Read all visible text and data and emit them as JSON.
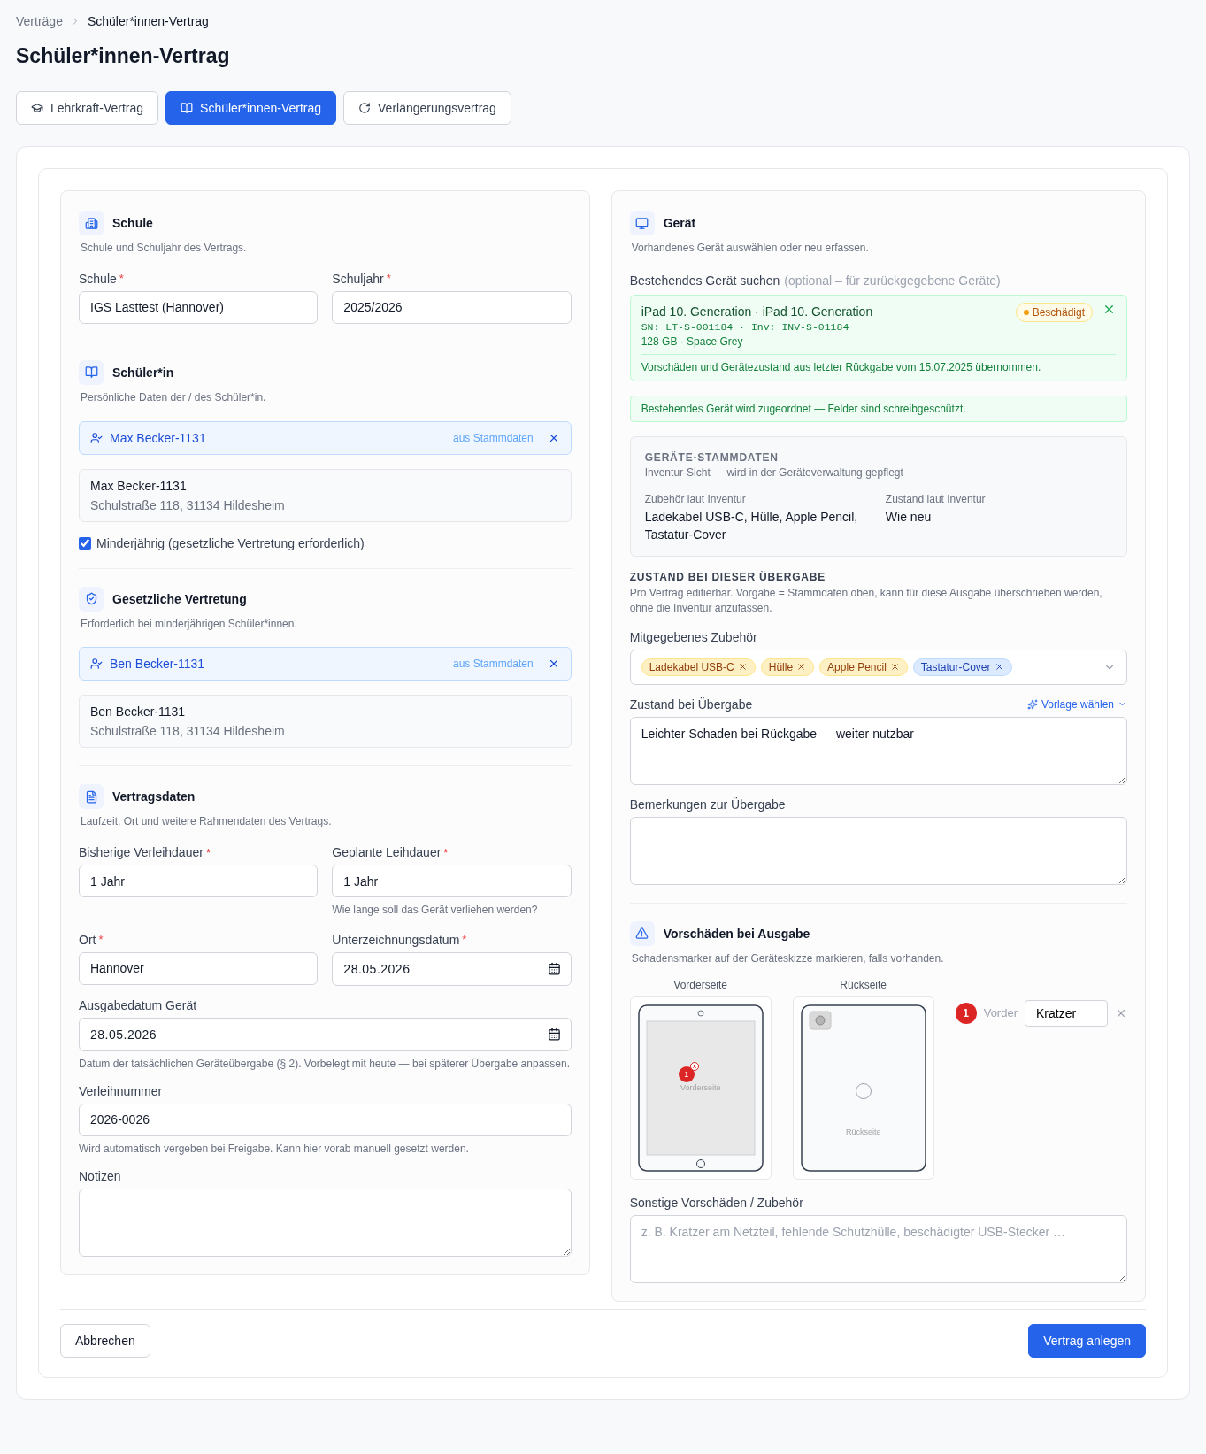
{
  "breadcrumb": [
    {
      "label": "Verträge",
      "current": false
    },
    {
      "label": "Schüler*innen-Vertrag",
      "current": true
    }
  ],
  "title": "Schüler*innen-Vertrag",
  "tabs": [
    {
      "label": "Lehrkraft-Vertrag",
      "selected": false
    },
    {
      "label": "Schüler*innen-Vertrag",
      "selected": true
    },
    {
      "label": "Verlängerungsvertrag",
      "selected": false
    }
  ],
  "required_mark": "*",
  "school": {
    "title": "Schule",
    "subtitle": "Schule und Schuljahr des Vertrags.",
    "fields": [
      {
        "label": "Schule",
        "required": true,
        "value": "IGS Lasttest (Hannover)"
      },
      {
        "label": "Schuljahr",
        "required": true,
        "value": "2025/2026"
      }
    ]
  },
  "student": {
    "title": "Schüler*in",
    "subtitle": "Persönliche Daten der / des Schüler*in.",
    "chip": {
      "name": "Max Becker-1131",
      "source": "aus Stammdaten"
    },
    "card": {
      "name": "Max Becker-1131",
      "address": "Schulstraße 118, 31134 Hildesheim"
    },
    "minor": {
      "label": "Minderjährig (gesetzliche Vertretung erforderlich)",
      "checked": true
    }
  },
  "guardian": {
    "title": "Gesetzliche Vertretung",
    "subtitle": "Erforderlich bei minderjährigen Schüler*innen.",
    "chip": {
      "name": "Ben Becker-1131",
      "source": "aus Stammdaten"
    },
    "card": {
      "name": "Ben Becker-1131",
      "address": "Schulstraße 118, 31134 Hildesheim"
    }
  },
  "contract": {
    "title": "Vertragsdaten",
    "subtitle": "Laufzeit, Ort und weitere Rahmendaten des Vertrags.",
    "grid_fields": [
      {
        "kind": "text",
        "label": "Bisherige Verleihdauer",
        "required": true,
        "value": "1 Jahr"
      },
      {
        "kind": "text",
        "label": "Geplante Leihdauer",
        "required": true,
        "value": "1 Jahr",
        "hint": "Wie lange soll das Gerät verliehen werden?"
      },
      {
        "kind": "text",
        "label": "Ort",
        "required": true,
        "value": "Hannover"
      },
      {
        "kind": "date",
        "label": "Unterzeichnungsdatum",
        "required": true,
        "value": "28.05.2026"
      }
    ],
    "wide_fields": [
      {
        "kind": "date",
        "label": "Ausgabedatum Gerät",
        "value": "28.05.2026",
        "hint": "Datum der tatsächlichen Geräteübergabe (§ 2). Vorbelegt mit heute — bei späterer Übergabe anpassen."
      },
      {
        "kind": "text",
        "label": "Verleihnummer",
        "value": "2026-0026",
        "hint": "Wird automatisch vergeben bei Freigabe. Kann hier vorab manuell gesetzt werden."
      },
      {
        "kind": "textarea",
        "label": "Notizen"
      }
    ]
  },
  "device": {
    "title": "Gerät",
    "subtitle": "Vorhandenes Gerät auswählen oder neu erfassen.",
    "search_label": "Bestehendes Gerät suchen",
    "search_hint": "(optional – für zurückgegebene Geräte)",
    "selected": {
      "name": "iPad 10. Generation · iPad 10. Generation",
      "ids": "SN: LT-S-001184 · Inv: INV-S-01184",
      "specs": "128 GB · Space Grey",
      "status": {
        "label": "Beschädigt",
        "color": "#f59e0b"
      },
      "note": "Vorschäden und Gerätezustand aus letzter Rückgabe vom 15.07.2025 übernommen."
    },
    "notice": "Bestehendes Gerät wird zugeordnet — Felder sind schreibgeschützt.",
    "master": {
      "heading": "GERÄTE-STAMMDATEN",
      "subtitle": "Inventur-Sicht — wird in der Geräteverwaltung gepflegt",
      "items": [
        {
          "label": "Zubehör laut Inventur",
          "value": "Ladekabel USB-C, Hülle, Apple Pencil, Tastatur-Cover"
        },
        {
          "label": "Zustand laut Inventur",
          "value": "Wie neu"
        }
      ]
    },
    "handover": {
      "heading": "ZUSTAND BEI DIESER ÜBERGABE",
      "subtitle": "Pro Vertrag editierbar. Vorgabe = Stammdaten oben, kann für diese Ausgabe überschrieben werden, ohne die Inventur anzufassen.",
      "accessories_label": "Mitgegebenes Zubehör",
      "accessories": [
        {
          "label": "Ladekabel USB-C",
          "kind": "inventory"
        },
        {
          "label": "Hülle",
          "kind": "inventory"
        },
        {
          "label": "Apple Pencil",
          "kind": "inventory"
        },
        {
          "label": "Tastatur-Cover",
          "kind": "extra"
        }
      ],
      "condition_label": "Zustand bei Übergabe",
      "template_button": "Vorlage wählen",
      "condition_value": "Leichter Schaden bei Rückgabe — weiter nutzbar",
      "remarks_label": "Bemerkungen zur Übergabe"
    }
  },
  "damage": {
    "title": "Vorschäden bei Ausgabe",
    "subtitle": "Schadensmarker auf der Geräteskizze markieren, falls vorhanden.",
    "sketches": [
      {
        "kind": "front",
        "label": "Vorderseite",
        "caption": "Vorderseite",
        "markers": [
          "1"
        ]
      },
      {
        "kind": "back",
        "label": "Rückseite",
        "caption": "Rückseite"
      }
    ],
    "entries": [
      {
        "number": "1",
        "side": "Vorder",
        "value": "Kratzer"
      }
    ],
    "other_label": "Sonstige Vorschäden / Zubehör",
    "other_placeholder": "z. B. Kratzer am Netzteil, fehlende Schutzhülle, beschädigter USB-Stecker …"
  },
  "footer": {
    "cancel": "Abbrechen",
    "submit": "Vertrag anlegen"
  }
}
